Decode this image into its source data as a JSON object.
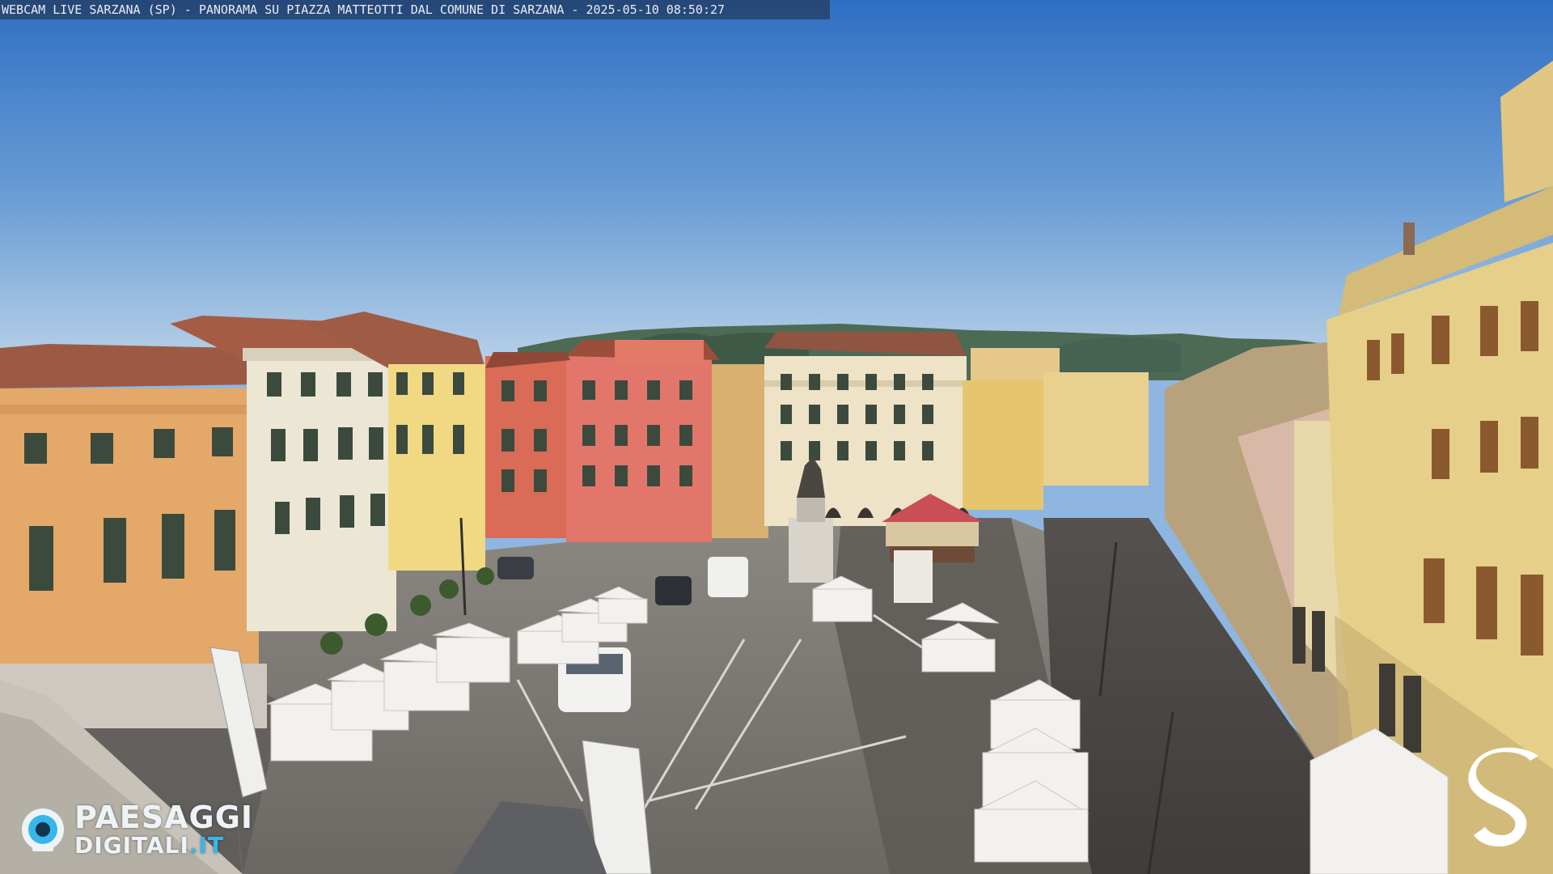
{
  "overlay": {
    "caption": "WEBCAM LIVE SARZANA (SP) - PANORAMA SU PIAZZA MATTEOTTI DAL COMUNE DI SARZANA - 2025-05-10  08:50:27"
  },
  "watermark": {
    "brand_top": "PAESAGGI",
    "brand_bottom_main": "DIGITALI",
    "brand_bottom_tld": ".IT",
    "corner_logo_letter": "S",
    "brand_icon": "eye-camera-icon",
    "brand_accent_color": "#38b6ea"
  },
  "scene": {
    "sky_top_color": "#2f78c9",
    "sky_horizon_color": "#bcd3e8"
  }
}
